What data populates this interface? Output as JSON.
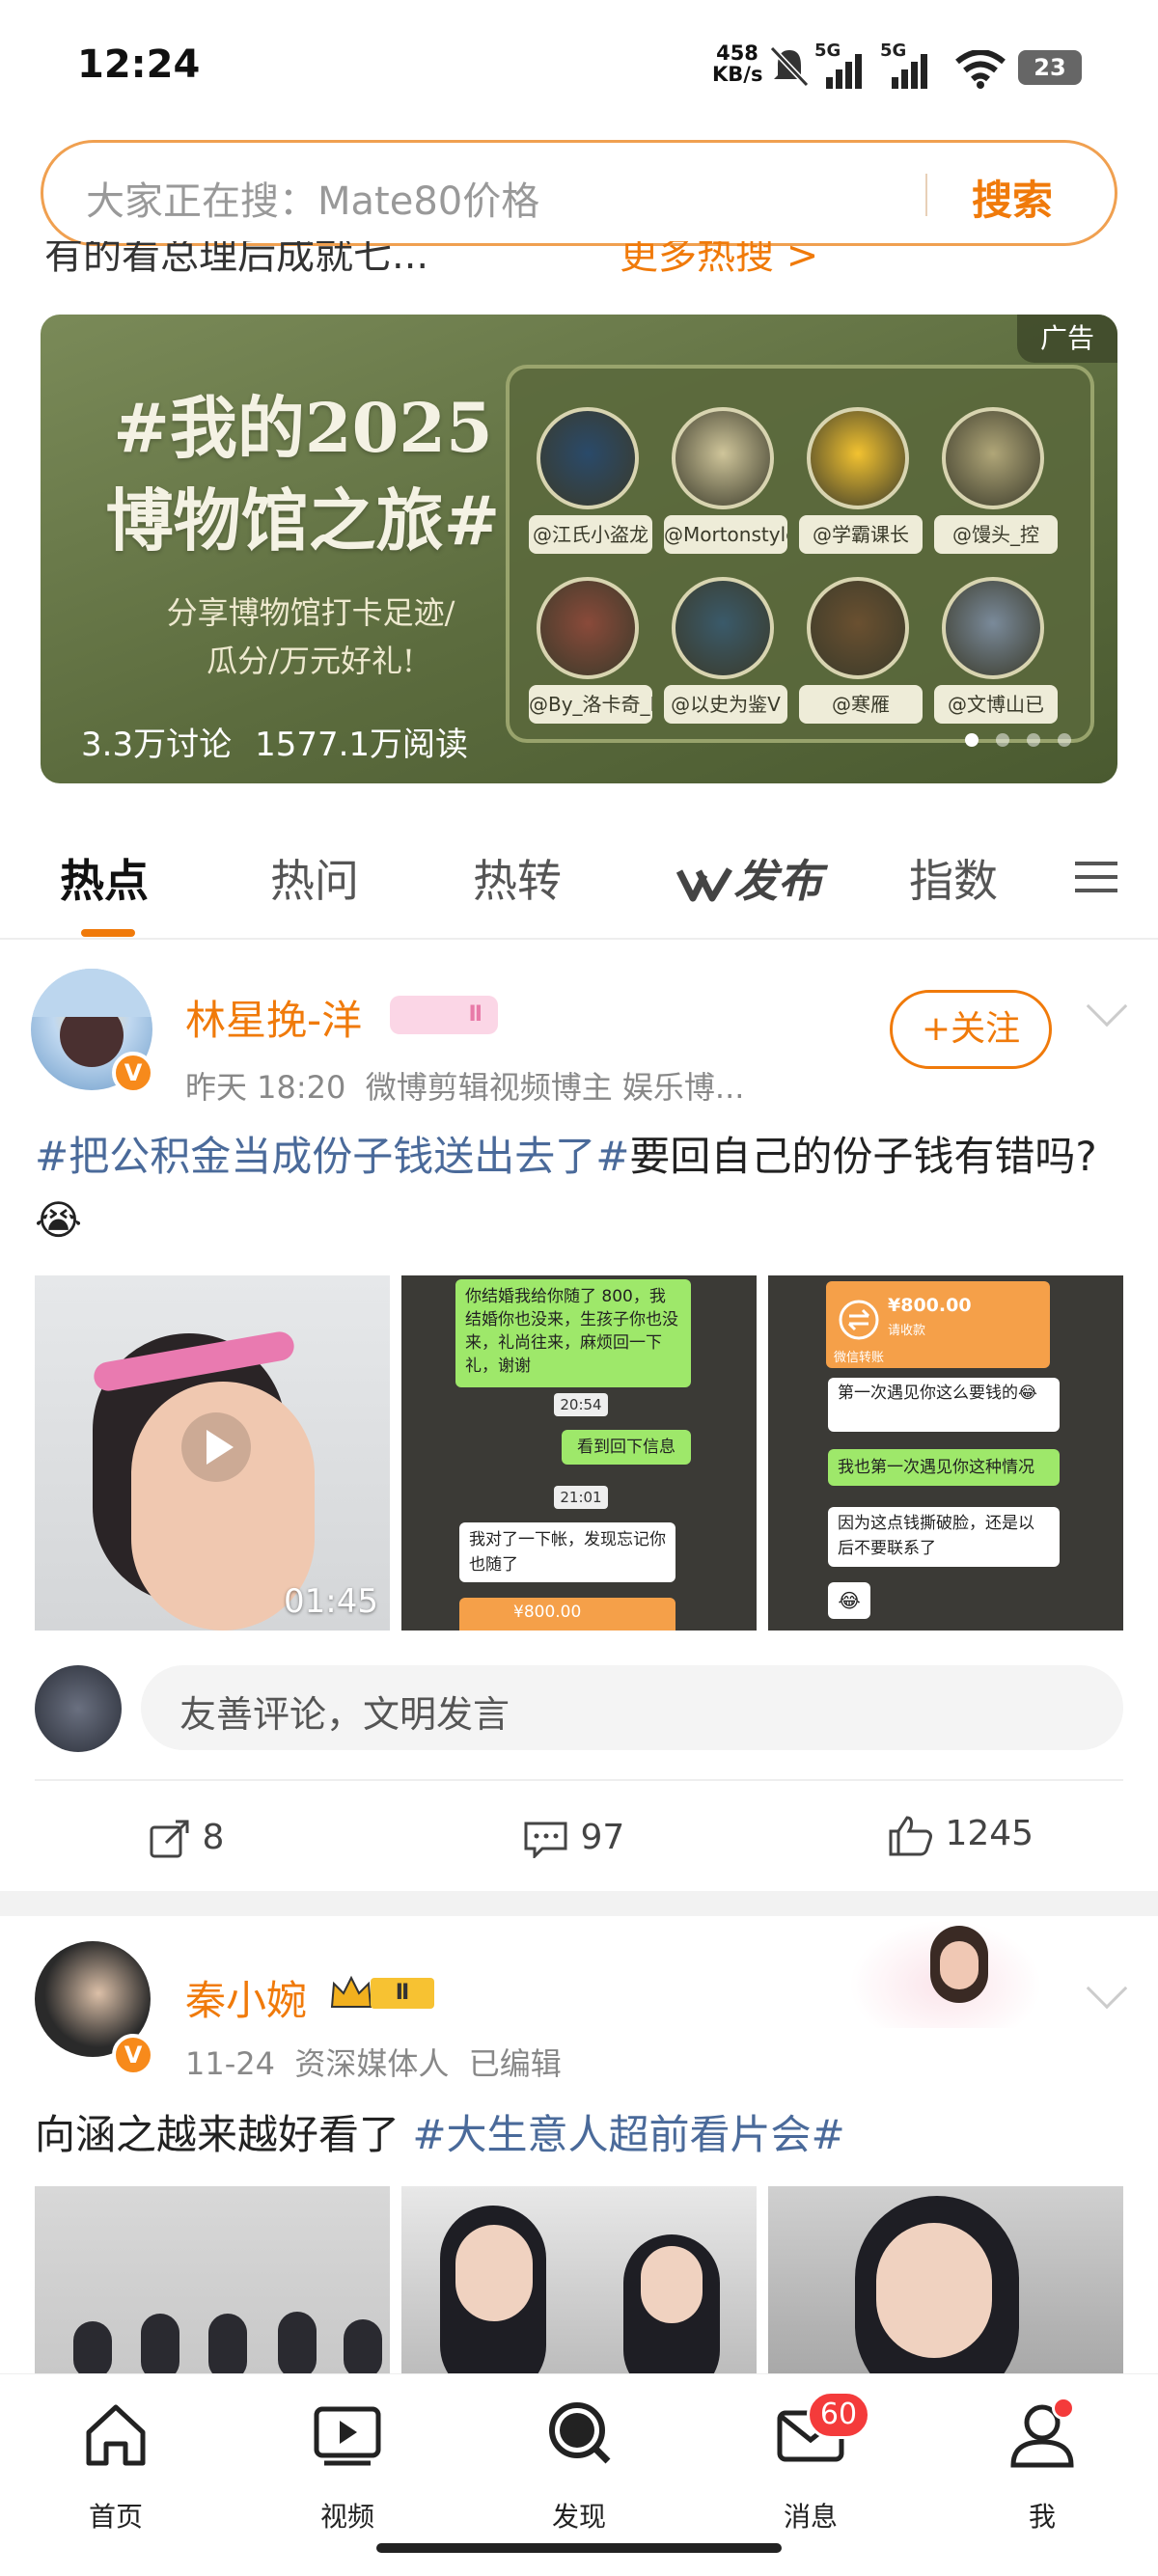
{
  "status_bar": {
    "time": "12:24",
    "net_speed": "458",
    "net_unit": "KB/s",
    "sig1": "5G",
    "sig2": "5G",
    "battery": "23"
  },
  "search": {
    "placeholder": "大家正在搜：Mate80价格",
    "button": "搜索"
  },
  "trending_peek": {
    "left": "有的看总理后成就七...",
    "right": "更多热搜 >"
  },
  "banner": {
    "ad_label": "广告",
    "title_line1": "#我的2025",
    "title_line2": "博物馆之旅#",
    "sub_line1": "分享博物馆打卡足迹/",
    "sub_line2": "瓜分/万元好礼!",
    "discussions": "3.3万讨论",
    "reads": "1577.1万阅读",
    "accounts": [
      "@江氏小盗龙",
      "@Mortonstyle",
      "@学霸课长",
      "@馒头_控",
      "@By_洛卡奇_LooKaqi",
      "@以史为鉴V",
      "@寒雁",
      "@文博山已"
    ],
    "avatar_colors": [
      "#2a4a6a",
      "#cfc59a",
      "#f2c230",
      "#b0a678",
      "#8a4a3a",
      "#3a5a6a",
      "#6a5030",
      "#7a8a9a"
    ],
    "page_count": 4,
    "active_page": 1
  },
  "tabs": [
    {
      "label": "热点",
      "active": true
    },
    {
      "label": "热问",
      "active": false
    },
    {
      "label": "热转",
      "active": false
    },
    {
      "label": "发布",
      "active": false
    },
    {
      "label": "指数",
      "active": false
    }
  ],
  "post1": {
    "user": "林星挽-洋",
    "level": "Ⅱ",
    "time": "昨天 18:20",
    "desc": "微博剪辑视频博主 娱乐博...",
    "follow": "+关注",
    "topic": "#把公积金当成份子钱送出去了#",
    "text": "要回自己的份子钱有错吗?😭",
    "video_duration": "01:45",
    "chat2": {
      "b1": "你结婚我给你随了 800，我结婚你也没来，生孩子你也没来，礼尚往来，麻烦回一下礼，谢谢",
      "t1": "20:54",
      "b2": "看到回下信息",
      "t2": "21:01",
      "b3": "我对了一下帐，发现忘记你也随了",
      "amt": "¥800.00"
    },
    "chat3": {
      "amt": "¥800.00",
      "amt_sub": "请收款",
      "sys": "微信转账",
      "b1": "第一次遇见你这么要钱的😂",
      "b2": "我也第一次遇见你这种情况",
      "b3": "因为这点钱撕破脸，还是以后不要联系了",
      "b4": "😂"
    },
    "comment_placeholder": "友善评论，文明发言",
    "reposts": "8",
    "comments": "97",
    "likes": "1245"
  },
  "post2": {
    "user": "秦小婉",
    "level": "Ⅱ",
    "time": "11-24",
    "desc": "资深媒体人",
    "edited": "已编辑",
    "text": "向涵之越来越好看了 ",
    "topic": "#大生意人超前看片会#"
  },
  "bottom_nav": [
    {
      "label": "首页",
      "icon": "home-icon"
    },
    {
      "label": "视频",
      "icon": "video-icon"
    },
    {
      "label": "发现",
      "icon": "discover-icon"
    },
    {
      "label": "消息",
      "icon": "message-icon",
      "badge": "60"
    },
    {
      "label": "我",
      "icon": "profile-icon"
    }
  ]
}
